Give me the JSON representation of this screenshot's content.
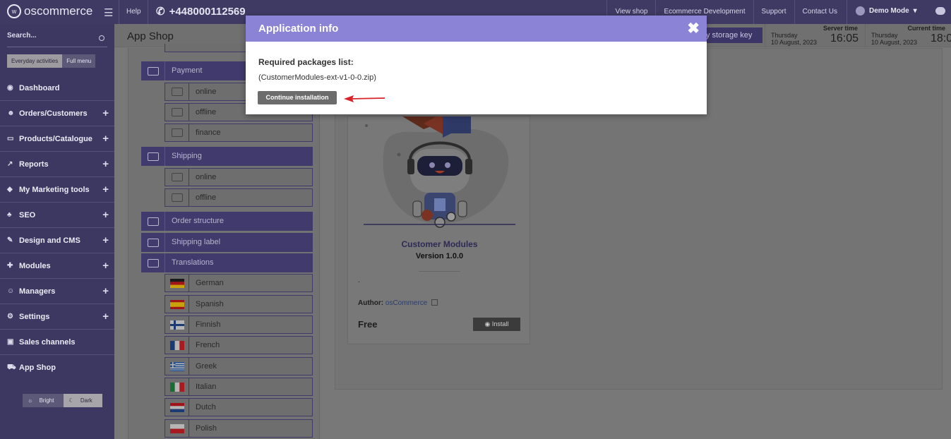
{
  "topbar": {
    "logo_text": "oscommerce",
    "help": "Help",
    "phone": "+448000112569",
    "links": [
      "View shop",
      "Ecommerce Development",
      "Support",
      "Contact Us"
    ],
    "user": "Demo Mode"
  },
  "sidebar": {
    "search_label": "Search...",
    "menu_toggle": [
      "Everyday activities",
      "Full menu"
    ],
    "items": [
      {
        "label": "Dashboard",
        "icon": "dashboard-icon",
        "expandable": false
      },
      {
        "label": "Orders/Customers",
        "icon": "users-icon",
        "expandable": true
      },
      {
        "label": "Products/Catalogue",
        "icon": "folder-icon",
        "expandable": true
      },
      {
        "label": "Reports",
        "icon": "chart-icon",
        "expandable": true
      },
      {
        "label": "My Marketing tools",
        "icon": "tag-icon",
        "expandable": true
      },
      {
        "label": "SEO",
        "icon": "sitemap-icon",
        "expandable": true
      },
      {
        "label": "Design and CMS",
        "icon": "brush-icon",
        "expandable": true
      },
      {
        "label": "Modules",
        "icon": "puzzle-icon",
        "expandable": true
      },
      {
        "label": "Managers",
        "icon": "user-icon",
        "expandable": true
      },
      {
        "label": "Settings",
        "icon": "gears-icon",
        "expandable": true
      },
      {
        "label": "Sales channels",
        "icon": "monitor-icon",
        "expandable": false
      },
      {
        "label": "App Shop",
        "icon": "cart-icon",
        "expandable": false
      }
    ],
    "theme": {
      "bright": "Bright",
      "dark": "Dark"
    }
  },
  "header": {
    "page_title": "App Shop",
    "storage_button": "y storage key",
    "server_time": {
      "label": "Server time",
      "day": "Thursday",
      "date": "10 August, 2023",
      "time": "16:05"
    },
    "current_time": {
      "label": "Current time",
      "day": "Thursday",
      "date": "10 August, 2023",
      "time": "18:0"
    }
  },
  "categories": {
    "payment": {
      "label": "Payment",
      "subs": [
        "online",
        "offline",
        "finance"
      ]
    },
    "shipping": {
      "label": "Shipping",
      "subs": [
        "online",
        "offline"
      ]
    },
    "order_structure": "Order structure",
    "shipping_label": "Shipping label",
    "translations": {
      "label": "Translations",
      "languages": [
        "German",
        "Spanish",
        "Finnish",
        "French",
        "Greek",
        "Italian",
        "Dutch",
        "Polish"
      ]
    }
  },
  "card": {
    "name": "Customer Modules",
    "version": "Version 1.0.0",
    "dot": ".",
    "author_label": "Author:",
    "author": "osCommerce",
    "price": "Free",
    "install_label": "Install"
  },
  "modal": {
    "title": "Application info",
    "close": "✖",
    "required_label": "Required packages list:",
    "package": "(CustomerModules-ext-v1-0-0.zip)",
    "continue_label": "Continue installation"
  },
  "colors": {
    "modal_header": "#8b84d6",
    "sidebar": "#3c3862",
    "arrow": "#d8232a"
  }
}
